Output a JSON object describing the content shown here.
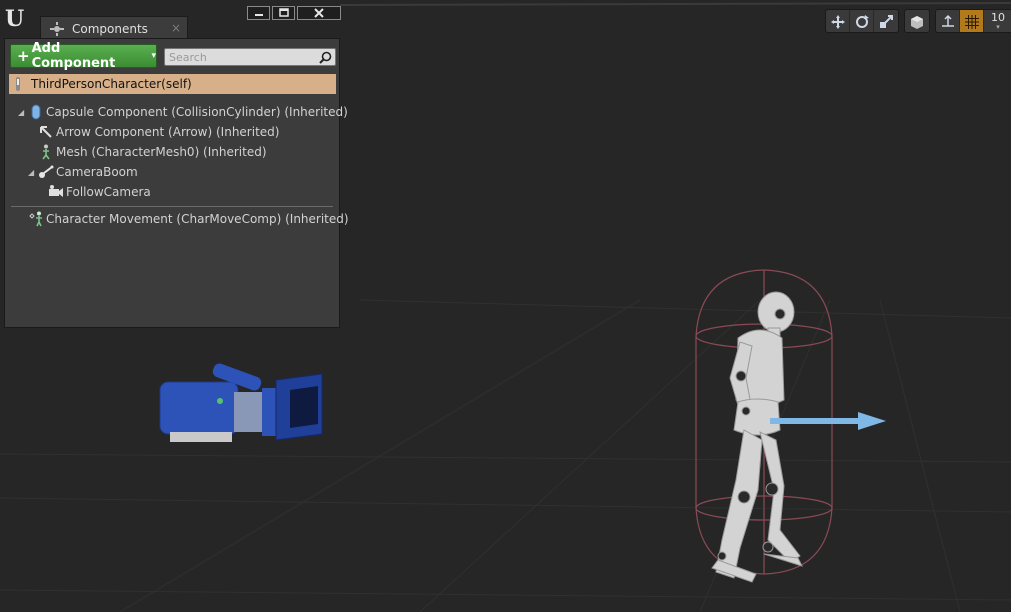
{
  "app": {
    "logo_letter": "U"
  },
  "tab": {
    "title": "Components",
    "close_glyph": "×"
  },
  "toolbar": {
    "add_component_label": "Add Component",
    "add_plus": "+",
    "dropdown_glyph": "▾"
  },
  "search": {
    "placeholder": "Search",
    "value": ""
  },
  "self_row": {
    "label": "ThirdPersonCharacter(self)"
  },
  "tree": [
    {
      "label": "Capsule Component (CollisionCylinder) (Inherited)",
      "icon": "capsule-icon",
      "expanded": true
    },
    {
      "label": "Arrow Component (Arrow) (Inherited)",
      "icon": "arrow-icon"
    },
    {
      "label": "Mesh (CharacterMesh0) (Inherited)",
      "icon": "mesh-icon"
    },
    {
      "label": "CameraBoom",
      "icon": "spring-arm-icon",
      "expanded": true
    },
    {
      "label": "FollowCamera",
      "icon": "camera-icon"
    }
  ],
  "movement": {
    "label": "Character Movement (CharMoveComp) (Inherited)",
    "icon": "character-movement-icon"
  },
  "viewport": {
    "snap_value": "10",
    "toolbar_icons": [
      "translate-icon",
      "rotate-icon",
      "scale-icon",
      "world-local-icon",
      "surface-snap-icon",
      "grid-snap-icon"
    ],
    "colors": {
      "background": "#262626",
      "capsule": "#8a4a55",
      "arrow": "#7fb7e6",
      "camera": "#2d52b8",
      "accent": "#b27a1a"
    }
  }
}
